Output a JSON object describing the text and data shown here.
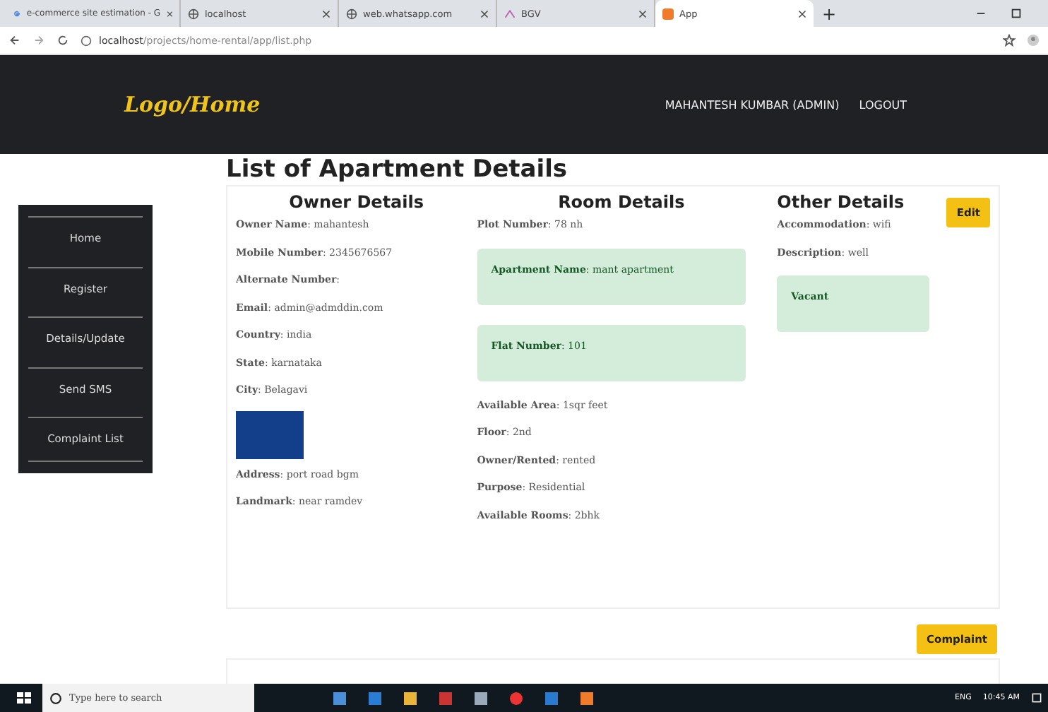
{
  "browser": {
    "tabs": [
      {
        "label": "e-commerce site estimation - G",
        "selected": false
      },
      {
        "label": "localhost",
        "selected": false
      },
      {
        "label": "web.whatsapp.com",
        "selected": false
      },
      {
        "label": "BGV",
        "selected": false
      },
      {
        "label": "App",
        "selected": true
      }
    ],
    "new_tab": "+",
    "address": {
      "host": "localhost",
      "path": "/projects/home-rental/app/list.php"
    }
  },
  "navbar": {
    "logo": "Logo/Home",
    "user": "MAHANTESH KUMBAR (ADMIN)",
    "logout": "LOGOUT"
  },
  "sidebar": {
    "items": [
      "Home",
      "Register",
      "Details/Update",
      "Send SMS",
      "Complaint List"
    ]
  },
  "page_title": "List of Apartment Details",
  "sections": [
    {
      "heading": "Owner Details",
      "fields": [
        {
          "kind": "text",
          "text": "**Owner Name**: mahantesh"
        },
        {
          "kind": "text",
          "text": "**Mobile Number**: 2345676567"
        },
        {
          "kind": "text",
          "text": "**Alternate Number**:"
        },
        {
          "kind": "text",
          "text": "**Email**: admin@admddin.com"
        },
        {
          "kind": "text",
          "text": "**Country**: india"
        },
        {
          "kind": "text",
          "text": "**State**: karnataka"
        },
        {
          "kind": "text",
          "text": "**City**: Belagavi"
        },
        {
          "kind": "photo"
        },
        {
          "kind": "text",
          "text": "**Address**: port road bgm"
        },
        {
          "kind": "text",
          "text": "**Landmark**: near ramdev"
        }
      ]
    },
    {
      "heading": "Room Details",
      "fields": [
        {
          "kind": "text",
          "text": "**Plot Number**: 78 nh"
        },
        {
          "kind": "box",
          "text": "**Apartment Name**: mant apartment"
        },
        {
          "kind": "box",
          "text": "**Flat Number**: 101"
        },
        {
          "kind": "text",
          "text": "**Available Area**: 1sqr feet"
        },
        {
          "kind": "text",
          "text": "**Floor**: 2nd"
        },
        {
          "kind": "text",
          "text": "**Owner/Rented**: rented"
        },
        {
          "kind": "text",
          "text": "**Purpose**: Residential"
        },
        {
          "kind": "text",
          "text": "**Available Rooms**: 2bhk"
        }
      ]
    },
    {
      "heading": "Other Details",
      "fields": [
        {
          "kind": "text",
          "text": "**Accommodation**: wifi"
        },
        {
          "kind": "text",
          "text": "**Description**: well"
        },
        {
          "kind": "box",
          "text": "**Vacant**"
        }
      ]
    }
  ],
  "edit_button": "Edit",
  "complaint_button": "Complaint",
  "taskbar": {
    "search_placeholder": "Type here to search",
    "language": "ENG",
    "time": "10:45 AM"
  }
}
